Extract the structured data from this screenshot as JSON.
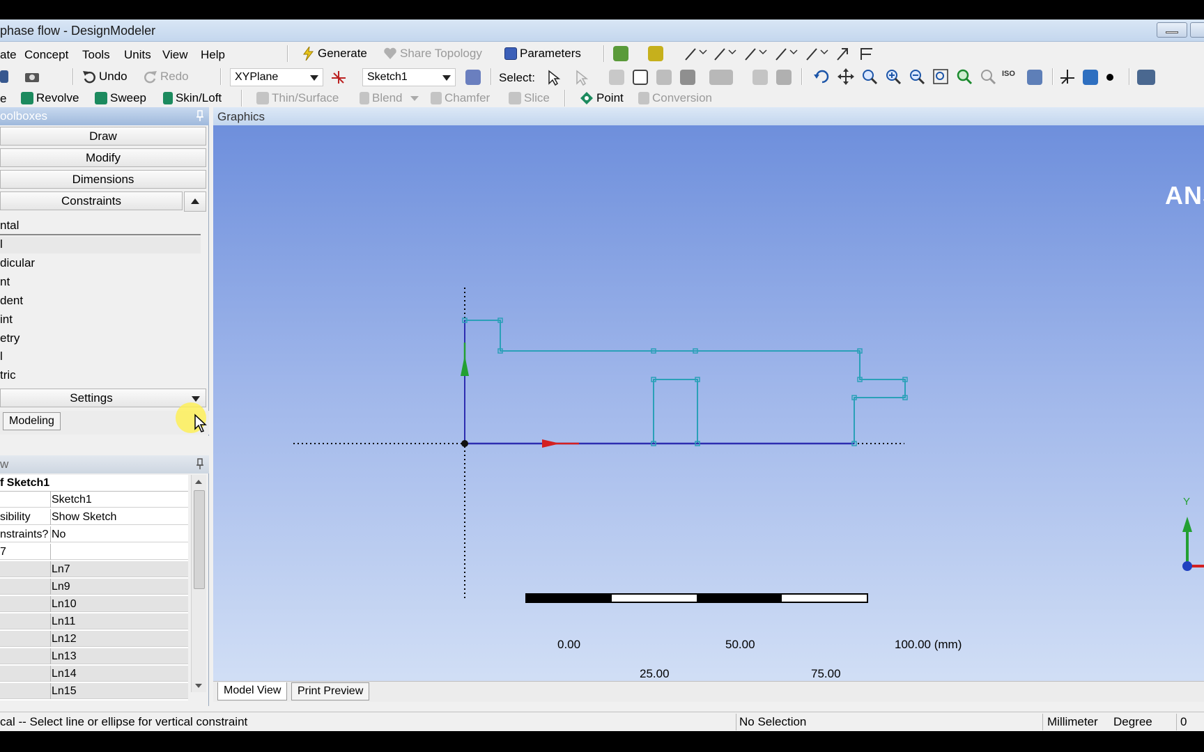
{
  "window": {
    "title": "phase flow - DesignModeler"
  },
  "menu": [
    "ate",
    "Concept",
    "Tools",
    "Units",
    "View",
    "Help"
  ],
  "toolbar1": {
    "generate": "Generate",
    "share_topology": "Share Topology",
    "parameters": "Parameters"
  },
  "toolbar2": {
    "undo": "Undo",
    "redo": "Redo",
    "plane": "XYPlane",
    "sketch": "Sketch1",
    "select_label": "Select:",
    "zoom_iso": "ISO"
  },
  "toolbar3": {
    "cut_label": "e",
    "revolve": "Revolve",
    "sweep": "Sweep",
    "skin_loft": "Skin/Loft",
    "thin_surface": "Thin/Surface",
    "blend": "Blend",
    "chamfer": "Chamfer",
    "slice": "Slice",
    "point": "Point",
    "conversion": "Conversion"
  },
  "toolboxes": {
    "title": "oolboxes",
    "groups": [
      "Draw",
      "Modify",
      "Dimensions",
      "Constraints"
    ],
    "constraints": [
      "ntal",
      "l",
      "dicular",
      "nt",
      "dent",
      "int",
      "etry",
      "l",
      "tric"
    ],
    "settings": "Settings",
    "tab_modeling": "Modeling"
  },
  "details": {
    "title": "w",
    "header": "f Sketch1",
    "rows": [
      {
        "k": "",
        "v": "Sketch1"
      },
      {
        "k": "sibility",
        "v": "Show Sketch"
      },
      {
        "k": "nstraints?",
        "v": "No"
      },
      {
        "k": "7",
        "v": ""
      },
      {
        "k": "",
        "v": "Ln7"
      },
      {
        "k": "",
        "v": "Ln9"
      },
      {
        "k": "",
        "v": "Ln10"
      },
      {
        "k": "",
        "v": "Ln11"
      },
      {
        "k": "",
        "v": "Ln12"
      },
      {
        "k": "",
        "v": "Ln13"
      },
      {
        "k": "",
        "v": "Ln14"
      },
      {
        "k": "",
        "v": "Ln15"
      }
    ]
  },
  "graphics": {
    "title": "Graphics",
    "logo": "ANS",
    "scale": {
      "top_labels": [
        "0.00",
        "50.00",
        "100.00 (mm)"
      ],
      "bottom_labels": [
        "25.00",
        "75.00"
      ]
    },
    "triad_y": "Y",
    "tabs": [
      "Model View",
      "Print Preview"
    ]
  },
  "status": {
    "message": "cal -- Select line or ellipse for vertical constraint",
    "selection": "No Selection",
    "length_unit": "Millimeter",
    "angle_unit": "Degree",
    "value": "0"
  },
  "colors": {
    "sketch": "#2aa0b8",
    "x_axis": "#d42020",
    "y_axis": "#23a032",
    "title_gradient": "#c4d7ee"
  }
}
